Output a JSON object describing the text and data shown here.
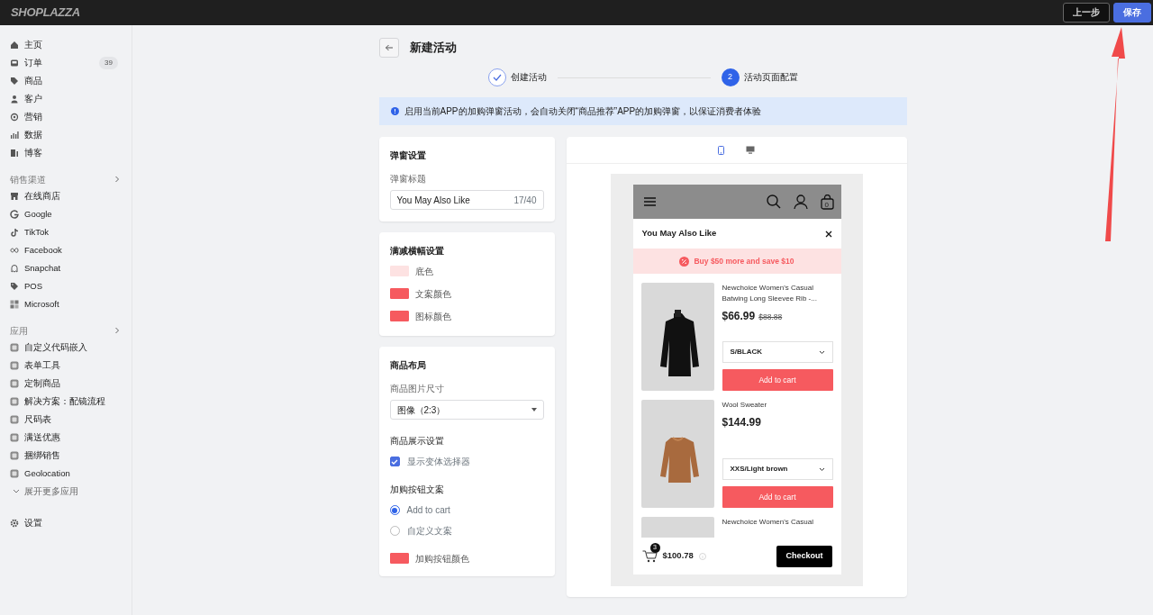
{
  "topbar": {
    "logo": "SHOPLAZZA",
    "buttons": [
      {
        "label": "上一步",
        "kind": "secondary"
      },
      {
        "label": "保存",
        "kind": "primary"
      }
    ]
  },
  "sidebar": {
    "main_items": [
      {
        "label": "主页"
      },
      {
        "label": "订单",
        "count": "39"
      },
      {
        "label": "商品"
      },
      {
        "label": "客户"
      },
      {
        "label": "营销"
      },
      {
        "label": "数据"
      },
      {
        "label": "博客"
      }
    ],
    "sections": [
      {
        "title": "销售渠道",
        "items": [
          {
            "label": "在线商店"
          },
          {
            "label": "Google"
          },
          {
            "label": "TikTok"
          },
          {
            "label": "Facebook"
          },
          {
            "label": "Snapchat"
          },
          {
            "label": "POS"
          },
          {
            "label": "Microsoft"
          }
        ]
      },
      {
        "title": "应用",
        "items": [
          {
            "label": "自定义代码嵌入"
          },
          {
            "label": "表单工具"
          },
          {
            "label": "定制商品"
          },
          {
            "label": "解决方案：配镜流程"
          },
          {
            "label": "尺码表"
          },
          {
            "label": "满送优惠"
          },
          {
            "label": "捆绑销售"
          },
          {
            "label": "Geolocation"
          }
        ],
        "more": "展开更多应用"
      }
    ],
    "settings": "设置"
  },
  "page": {
    "title": "新建活动",
    "steps": [
      {
        "label": "创建活动",
        "done": true
      },
      {
        "label": "活动页面配置",
        "number": "2",
        "done": false
      }
    ],
    "alert": "启用当前APP的加购弹窗活动，会自动关闭“商品推荐”APP的加购弹窗，以保证消费者体验"
  },
  "popup_settings": {
    "title": "弹窗设置",
    "field_label": "弹窗标题",
    "value": "You May Also Like",
    "counter": "17/40"
  },
  "banner_settings": {
    "title": "满减横幅设置",
    "colors": [
      {
        "label": "底色",
        "color": "#fde2e2"
      },
      {
        "label": "文案颜色",
        "color": "#f65a5f"
      },
      {
        "label": "图标颜色",
        "color": "#f65a5f"
      }
    ]
  },
  "layout_settings": {
    "title": "商品布局",
    "image_size_label": "商品图片尺寸",
    "image_size": "图像（2:3）",
    "display_label": "商品展示设置",
    "checkbox": {
      "label": "显示变体选择器",
      "checked": true
    },
    "button_text_label": "加购按钮文案",
    "radios": [
      {
        "label": "Add to cart",
        "selected": true
      },
      {
        "label": "自定义文案",
        "selected": false
      }
    ],
    "button_color": {
      "label": "加购按钮颜色",
      "color": "#f65a5f"
    }
  },
  "preview": {
    "devices": [
      {
        "kind": "mobile",
        "selected": true
      },
      {
        "kind": "desktop",
        "selected": false
      }
    ],
    "cart_count": "0",
    "popup_title": "You May Also Like",
    "banner": "Buy $50 more and save $10",
    "products": [
      {
        "name": "Newchoice Women's Casual Batwing Long Sleevee Rib -...",
        "price": "$66.99",
        "compare_price": "$88.88",
        "variant": "S/BLACK",
        "button": "Add to cart"
      },
      {
        "name": "Wool Sweater",
        "price": "$144.99",
        "variant": "XXS/Light brown",
        "button": "Add to cart"
      },
      {
        "name": "Newchoice Women's Casual"
      }
    ],
    "footer": {
      "count": "3",
      "total": "$100.78",
      "checkout": "Checkout"
    }
  }
}
